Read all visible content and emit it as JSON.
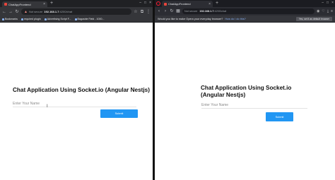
{
  "left_browser": {
    "tab_title": "ChatAppFrontend",
    "address": {
      "security_label": "Not secure",
      "url_host": "192.168.1.7",
      "url_rest": ":4200/chat"
    },
    "bookmarks": [
      "Bookmarks",
      "required plugin",
      "Advertising Script F...",
      "Bagusbie Field - 1000..."
    ],
    "page": {
      "heading": "Chat Application Using Socket.io (Angular Nestjs)",
      "input_placeholder": "Enter Your Name",
      "submit_label": "Submit"
    }
  },
  "right_browser": {
    "tab_title": "ChatAppFrontend",
    "address": {
      "security_label": "Not secure",
      "url_host": "192.168.1.7",
      "url_rest": ":4200/chat"
    },
    "default_prompt": {
      "message": "Would you like to make Opera your everyday browser?",
      "link": "How do I do this?",
      "button": "Yes, set it as default browser"
    },
    "page": {
      "heading": "Chat Application Using Socket.io (Angular Nestjs)",
      "input_placeholder": "Enter Your Name",
      "submit_label": "Submit"
    }
  },
  "icons": {
    "back": "arrow-left",
    "forward": "arrow-right",
    "reload": "reload",
    "warning": "warning-triangle",
    "close": "close",
    "new_tab": "plus"
  },
  "colors": {
    "submit_button": "#2196f3",
    "chrome_dark": "#35363a",
    "opera_red": "#ff1b2d"
  }
}
